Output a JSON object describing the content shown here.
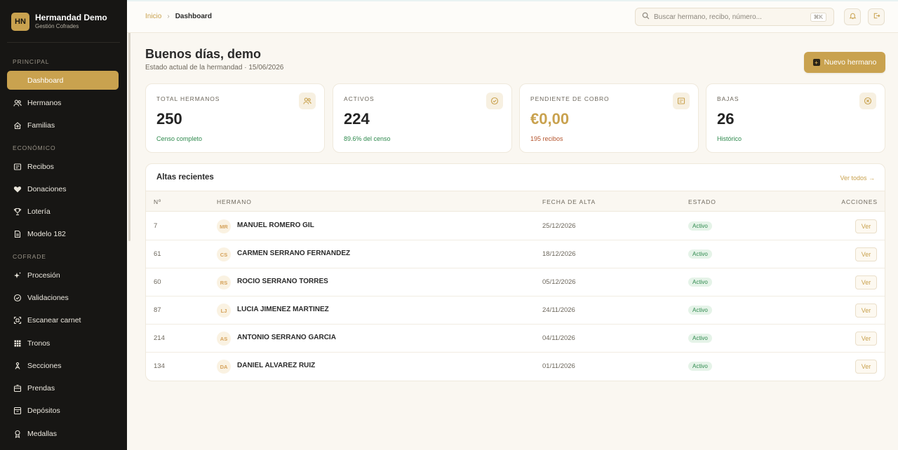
{
  "brand": {
    "initials": "HN",
    "name": "Hermandad Demo",
    "subtitle": "Gestión Cofrades"
  },
  "sidebar": {
    "sections": [
      {
        "label": "PRINCIPAL",
        "items": [
          {
            "label": "Dashboard",
            "icon": "home-icon",
            "active": true
          },
          {
            "label": "Hermanos",
            "icon": "users-icon"
          },
          {
            "label": "Familias",
            "icon": "family-home-icon"
          }
        ]
      },
      {
        "label": "ECONÓMICO",
        "items": [
          {
            "label": "Recibos",
            "icon": "receipt-icon"
          },
          {
            "label": "Donaciones",
            "icon": "heart-icon"
          },
          {
            "label": "Lotería",
            "icon": "trophy-icon"
          },
          {
            "label": "Modelo 182",
            "icon": "document-icon"
          }
        ]
      },
      {
        "label": "COFRADE",
        "items": [
          {
            "label": "Procesión",
            "icon": "sparkle-icon"
          },
          {
            "label": "Validaciones",
            "icon": "check-circle-icon"
          },
          {
            "label": "Escanear carnet",
            "icon": "scan-icon"
          },
          {
            "label": "Tronos",
            "icon": "grid-icon"
          },
          {
            "label": "Secciones",
            "icon": "person-icon"
          },
          {
            "label": "Prendas",
            "icon": "box-icon"
          },
          {
            "label": "Depósitos",
            "icon": "archive-icon"
          },
          {
            "label": "Medallas",
            "icon": "medal-icon"
          }
        ]
      }
    ]
  },
  "header": {
    "breadcrumb_home": "Inicio",
    "breadcrumb_sep": "›",
    "breadcrumb_current": "Dashboard",
    "search_placeholder": "Buscar hermano, recibo, número...",
    "search_shortcut": "⌘K"
  },
  "main": {
    "greeting": "Buenos días, demo",
    "subtitle": "Estado actual de la hermandad · 15/06/2026",
    "new_button": "Nuevo hermano",
    "new_button_icon": "+"
  },
  "stats": [
    {
      "label": "TOTAL HERMANOS",
      "value": "250",
      "note": "Censo completo",
      "icon": "users-icon"
    },
    {
      "label": "ACTIVOS",
      "value": "224",
      "note": "89.6% del censo",
      "icon": "check-circle-icon"
    },
    {
      "label": "PENDIENTE DE COBRO",
      "value": "€0,00",
      "note": "195 recibos",
      "icon": "receipt-icon"
    },
    {
      "label": "BAJAS",
      "value": "26",
      "note": "Histórico",
      "icon": "x-circle-icon"
    }
  ],
  "recent": {
    "title": "Altas recientes",
    "link": "Ver todos →",
    "columns": [
      "Nº",
      "HERMANO",
      "FECHA DE ALTA",
      "ESTADO",
      "ACCIONES"
    ],
    "rows": [
      {
        "num": "7",
        "initials": "MR",
        "name": "MANUEL ROMERO GIL",
        "date": "25/12/2026",
        "status": "Activo",
        "action": "Ver"
      },
      {
        "num": "61",
        "initials": "CS",
        "name": "CARMEN SERRANO FERNANDEZ",
        "date": "18/12/2026",
        "status": "Activo",
        "action": "Ver"
      },
      {
        "num": "60",
        "initials": "RS",
        "name": "ROCIO SERRANO TORRES",
        "date": "05/12/2026",
        "status": "Activo",
        "action": "Ver"
      },
      {
        "num": "87",
        "initials": "LJ",
        "name": "LUCIA JIMENEZ MARTINEZ",
        "date": "24/11/2026",
        "status": "Activo",
        "action": "Ver"
      },
      {
        "num": "214",
        "initials": "AS",
        "name": "ANTONIO SERRANO GARCIA",
        "date": "04/11/2026",
        "status": "Activo",
        "action": "Ver"
      },
      {
        "num": "134",
        "initials": "DA",
        "name": "DANIEL ALVAREZ RUIZ",
        "date": "01/11/2026",
        "status": "Activo",
        "action": "Ver"
      }
    ]
  },
  "colors": {
    "accent": "#c9a24f",
    "sidebar_bg": "#171614",
    "page_bg": "#faf7f1",
    "success": "#2f8a4e",
    "warning": "#b5562f"
  }
}
